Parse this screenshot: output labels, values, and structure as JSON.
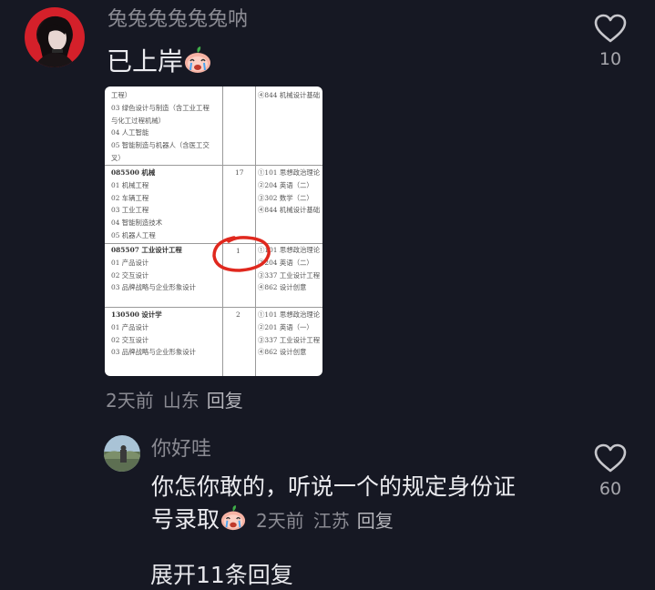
{
  "comment": {
    "username": "兔兔兔兔兔兔呐",
    "content": "已上岸",
    "emoji": "crying-peach-emoji",
    "likes": "10",
    "time": "2天前",
    "location": "山东",
    "reply_label": "回复",
    "attachment": {
      "top_rows": [
        "工程）",
        "03 绿色设计与制造（含工业工程",
        "与化工过程机械）",
        "04 人工智能",
        "05 智能制造与机器人（含医工交",
        "叉）"
      ],
      "top_exam": [
        "④844 机械设计基础"
      ],
      "sections": [
        {
          "code_name": "085500 机械",
          "quota": "17",
          "directions": [
            "01 机械工程",
            "02 车辆工程",
            "03 工业工程",
            "04 智能制造技术",
            "05 机器人工程"
          ],
          "exams": [
            "①101 思想政治理论",
            "②204 英语（二）",
            "③302 数学（二）",
            "④844 机械设计基础"
          ]
        },
        {
          "code_name": "085507 工业设计工程",
          "quota": "1",
          "directions": [
            "01 产品设计",
            "02 交互设计",
            "03 品牌战略与企业形象设计"
          ],
          "exams": [
            "①101 思想政治理论",
            "②204 英语（二）",
            "③337 工业设计工程",
            "④862 设计创意"
          ]
        },
        {
          "code_name": "130500 设计学",
          "quota": "2",
          "directions": [
            "01 产品设计",
            "02 交互设计",
            "03 品牌战略与企业形象设计"
          ],
          "exams": [
            "①101 思想政治理论",
            "②201 英语（一）",
            "③337 工业设计工程",
            "④862 设计创意"
          ]
        }
      ]
    }
  },
  "reply": {
    "username": "你好哇",
    "content_line1": "你怎你敢的，听说一个的规定身份证",
    "content_line2": "号录取",
    "emoji": "crying-peach-emoji",
    "likes": "60",
    "time": "2天前",
    "location": "江苏",
    "reply_label": "回复"
  },
  "expand_replies": "展开11条回复",
  "colors": {
    "background": "#161823",
    "username": "#8b8b93",
    "text": "#ececf0",
    "highlight_circle": "#e0281e"
  }
}
